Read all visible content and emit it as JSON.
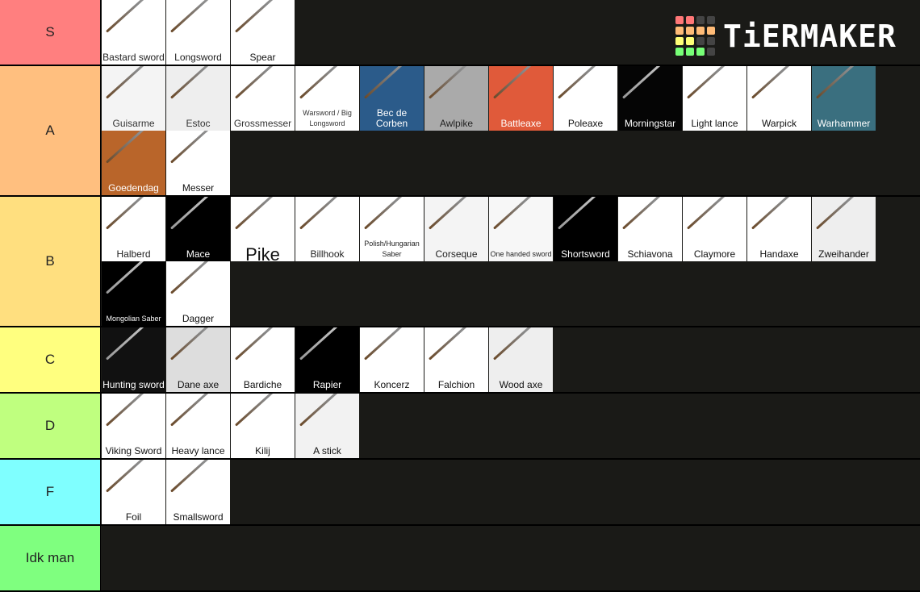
{
  "logo": {
    "text": "TiERMAKER",
    "grid": [
      "#f77",
      "#f77",
      "#444",
      "#444",
      "#fb7",
      "#fb7",
      "#fb7",
      "#fb7",
      "#ff7",
      "#ff7",
      "#444",
      "#444",
      "#7f7",
      "#7f7",
      "#7f7",
      "#444"
    ]
  },
  "tiers": [
    {
      "label": "S",
      "color": "#ff7f7f",
      "items": [
        {
          "name": "Bastard sword",
          "bg": "#fff",
          "fg": "#222"
        },
        {
          "name": "Longsword",
          "bg": "#fff",
          "fg": "#222"
        },
        {
          "name": "Spear",
          "bg": "#fff",
          "fg": "#111"
        }
      ]
    },
    {
      "label": "A",
      "color": "#ffbf7f",
      "items": [
        {
          "name": "Guisarme",
          "bg": "#f4f4f4",
          "fg": "#333"
        },
        {
          "name": "Estoc",
          "bg": "#eee",
          "fg": "#333"
        },
        {
          "name": "Grossmesser",
          "bg": "#fff",
          "fg": "#333"
        },
        {
          "name": "Warsword / Big Longsword",
          "bg": "#fff",
          "fg": "#333"
        },
        {
          "name": "Bec de Corben",
          "bg": "#2b5b8a",
          "fg": "#fff"
        },
        {
          "name": "Awlpike",
          "bg": "#aaa",
          "fg": "#222"
        },
        {
          "name": "Battleaxe",
          "bg": "#e05a3a",
          "fg": "#fff"
        },
        {
          "name": "Poleaxe",
          "bg": "#fff",
          "fg": "#111"
        },
        {
          "name": "Morningstar",
          "bg": "#050505",
          "fg": "#fff"
        },
        {
          "name": "Light lance",
          "bg": "#fff",
          "fg": "#111"
        },
        {
          "name": "Warpick",
          "bg": "#fff",
          "fg": "#111"
        },
        {
          "name": "Warhammer",
          "bg": "#3a6f7f",
          "fg": "#fff"
        },
        {
          "name": "Goedendag",
          "bg": "#b9652a",
          "fg": "#fff"
        },
        {
          "name": "Messer",
          "bg": "#fff",
          "fg": "#111"
        }
      ]
    },
    {
      "label": "B",
      "color": "#ffdf7f",
      "items": [
        {
          "name": "Halberd",
          "bg": "#fff",
          "fg": "#222"
        },
        {
          "name": "Mace",
          "bg": "#000",
          "fg": "#fff"
        },
        {
          "name": "Pike",
          "bg": "#fff",
          "fg": "#111"
        },
        {
          "name": "Billhook",
          "bg": "#fff",
          "fg": "#222"
        },
        {
          "name": "Polish/Hungarian Saber",
          "bg": "#fff",
          "fg": "#222"
        },
        {
          "name": "Corseque",
          "bg": "#f4f4f4",
          "fg": "#222"
        },
        {
          "name": "One handed sword",
          "bg": "#f7f7f7",
          "fg": "#222"
        },
        {
          "name": "Shortsword",
          "bg": "#000",
          "fg": "#fff"
        },
        {
          "name": "Schiavona",
          "bg": "#fff",
          "fg": "#111"
        },
        {
          "name": "Claymore",
          "bg": "#fff",
          "fg": "#111"
        },
        {
          "name": "Handaxe",
          "bg": "#fff",
          "fg": "#111"
        },
        {
          "name": "Zweihander",
          "bg": "#eee",
          "fg": "#111"
        },
        {
          "name": "Mongolian Saber",
          "bg": "#000",
          "fg": "#fff"
        },
        {
          "name": "Dagger",
          "bg": "#fff",
          "fg": "#111"
        }
      ]
    },
    {
      "label": "C",
      "color": "#ffff7f",
      "items": [
        {
          "name": "Hunting sword",
          "bg": "#111",
          "fg": "#fff"
        },
        {
          "name": "Dane axe",
          "bg": "#ddd",
          "fg": "#111"
        },
        {
          "name": "Bardiche",
          "bg": "#fff",
          "fg": "#111"
        },
        {
          "name": "Rapier",
          "bg": "#000",
          "fg": "#fff"
        },
        {
          "name": "Koncerz",
          "bg": "#fff",
          "fg": "#111"
        },
        {
          "name": "Falchion",
          "bg": "#fff",
          "fg": "#111"
        },
        {
          "name": "Wood axe",
          "bg": "#eee",
          "fg": "#111"
        }
      ]
    },
    {
      "label": "D",
      "color": "#bfff7f",
      "items": [
        {
          "name": "Viking Sword",
          "bg": "#fff",
          "fg": "#111"
        },
        {
          "name": "Heavy lance",
          "bg": "#fff",
          "fg": "#111"
        },
        {
          "name": "Kilij",
          "bg": "#fff",
          "fg": "#111"
        },
        {
          "name": "A stick",
          "bg": "#f2f2f2",
          "fg": "#111"
        }
      ]
    },
    {
      "label": "F",
      "color": "#7fffff",
      "items": [
        {
          "name": "Foil",
          "bg": "#fff",
          "fg": "#111"
        },
        {
          "name": "Smallsword",
          "bg": "#fff",
          "fg": "#111"
        }
      ]
    },
    {
      "label": "Idk man",
      "color": "#7fff7f",
      "items": []
    }
  ]
}
